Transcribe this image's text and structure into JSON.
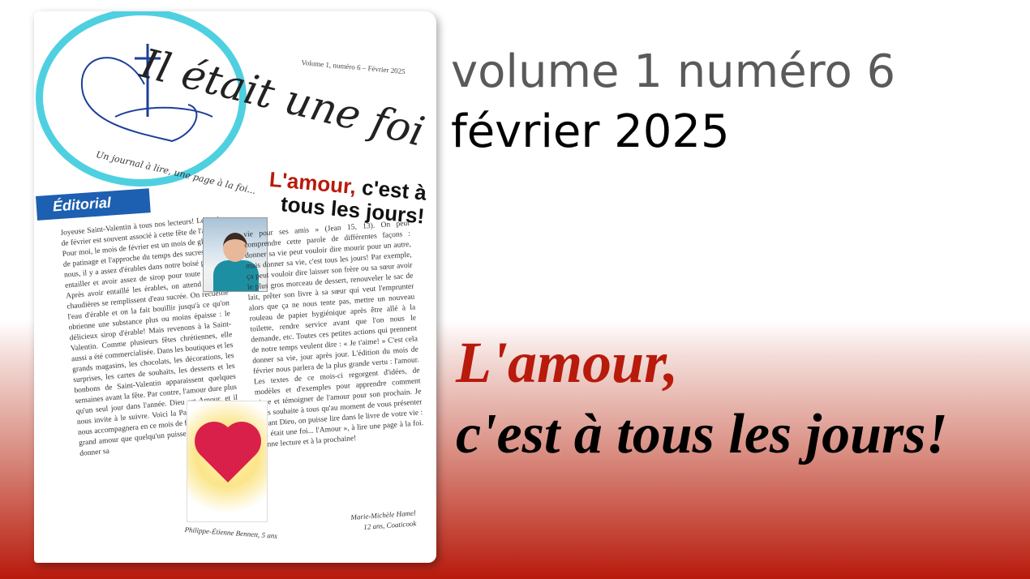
{
  "magazine": {
    "logo_title": "Il était une foi",
    "logo_tagline": "Un journal à lire, une page à la foi...",
    "issue_label": "Volume 1, numéro 6 – Février 2025",
    "headline_red": "L'amour,",
    "headline_rest": "c'est à tous les jours!",
    "editorial_tab": "Éditorial",
    "left_column_text": "Joyeuse Saint-Valentin à tous nos lecteurs! Le mois de février est souvent associé à cette fête de l'amour. Pour moi, le mois de février est un mois de glissade, de patinage et l'approche du temps des sucres! Chez nous, il y a assez d'érables dans notre boisé pour les entailler et avoir assez de sirop pour toute l'année. Après avoir entaillé les érables, on attend que les chaudières se remplissent d'eau sucrée. On recueille l'eau d'érable et on la fait bouillir jusqu'à ce qu'on obtienne une substance plus ou moins épaisse : le délicieux sirop d'érable! Mais revenons à la Saint-Valentin. Comme plusieurs fêtes chrétiennes, elle aussi a été commercialisée. Dans les boutiques et les grands magasins, les chocolats, les décorations, les surprises, les cartes de souhaits, les desserts et les bonbons de Saint-Valentin apparaissent quelques semaines avant la fête. Par contre, l'amour dure plus qu'un seul jour dans l'année. Dieu est Amour, et il nous invite à le suivre. Voici la Parole de Dieu qui nous accompagnera en ce mois de février : « Le plus grand amour que quelqu'un puisse montrer, c'est de donner sa",
    "right_column_text": "vie pour ses amis » (Jean 15, 13). On peut comprendre cette parole de différentes façons : donner sa vie peut vouloir dire mourir pour un autre, mais donner sa vie, c'est tous les jours! Par exemple, ça peut vouloir dire laisser son frère ou sa sœur avoir le plus gros morceau de dessert, renouveler le sac de lait, prêter son livre à sa sœur qui veut l'emprunter alors que ça ne nous tente pas, mettre un nouveau rouleau de papier hygiénique après être allé à la toilette, rendre service avant que l'on nous le demande, etc. Toutes ces petites actions qui prennent de notre temps veulent dire : « Je t'aime! » C'est cela donner sa vie, jour après jour. L'édition du mois de février nous parlera de la plus grande vertu : l'amour. Les textes de ce mois-ci regorgent d'idées, de modèles et d'exemples pour apprendre comment vivre et témoigner de l'amour pour son prochain. Je vous souhaite à tous qu'au moment de vous présenter devant Dieu, on puisse lire dans le livre de votre vie : « Il était une foi... l'Amour », à lire une page à la foi. Bonne lecture et à la prochaine!",
    "drawing_caption": "Philippe-Étienne Bennett, 5 ans",
    "signature_name": "Marie-Michèle Hamel",
    "signature_detail": "12 ans, Coaticook"
  },
  "issue_line": "volume 1 numéro 6",
  "date_line": "février 2025",
  "headline": {
    "line1": "L'amour,",
    "line2": "c'est à tous les jours!"
  },
  "colors": {
    "accent_red": "#b81a0c",
    "issue_gray": "#5a5a5a",
    "logo_cyan": "#4fd0e0",
    "editorial_blue": "#1d5fb0"
  }
}
